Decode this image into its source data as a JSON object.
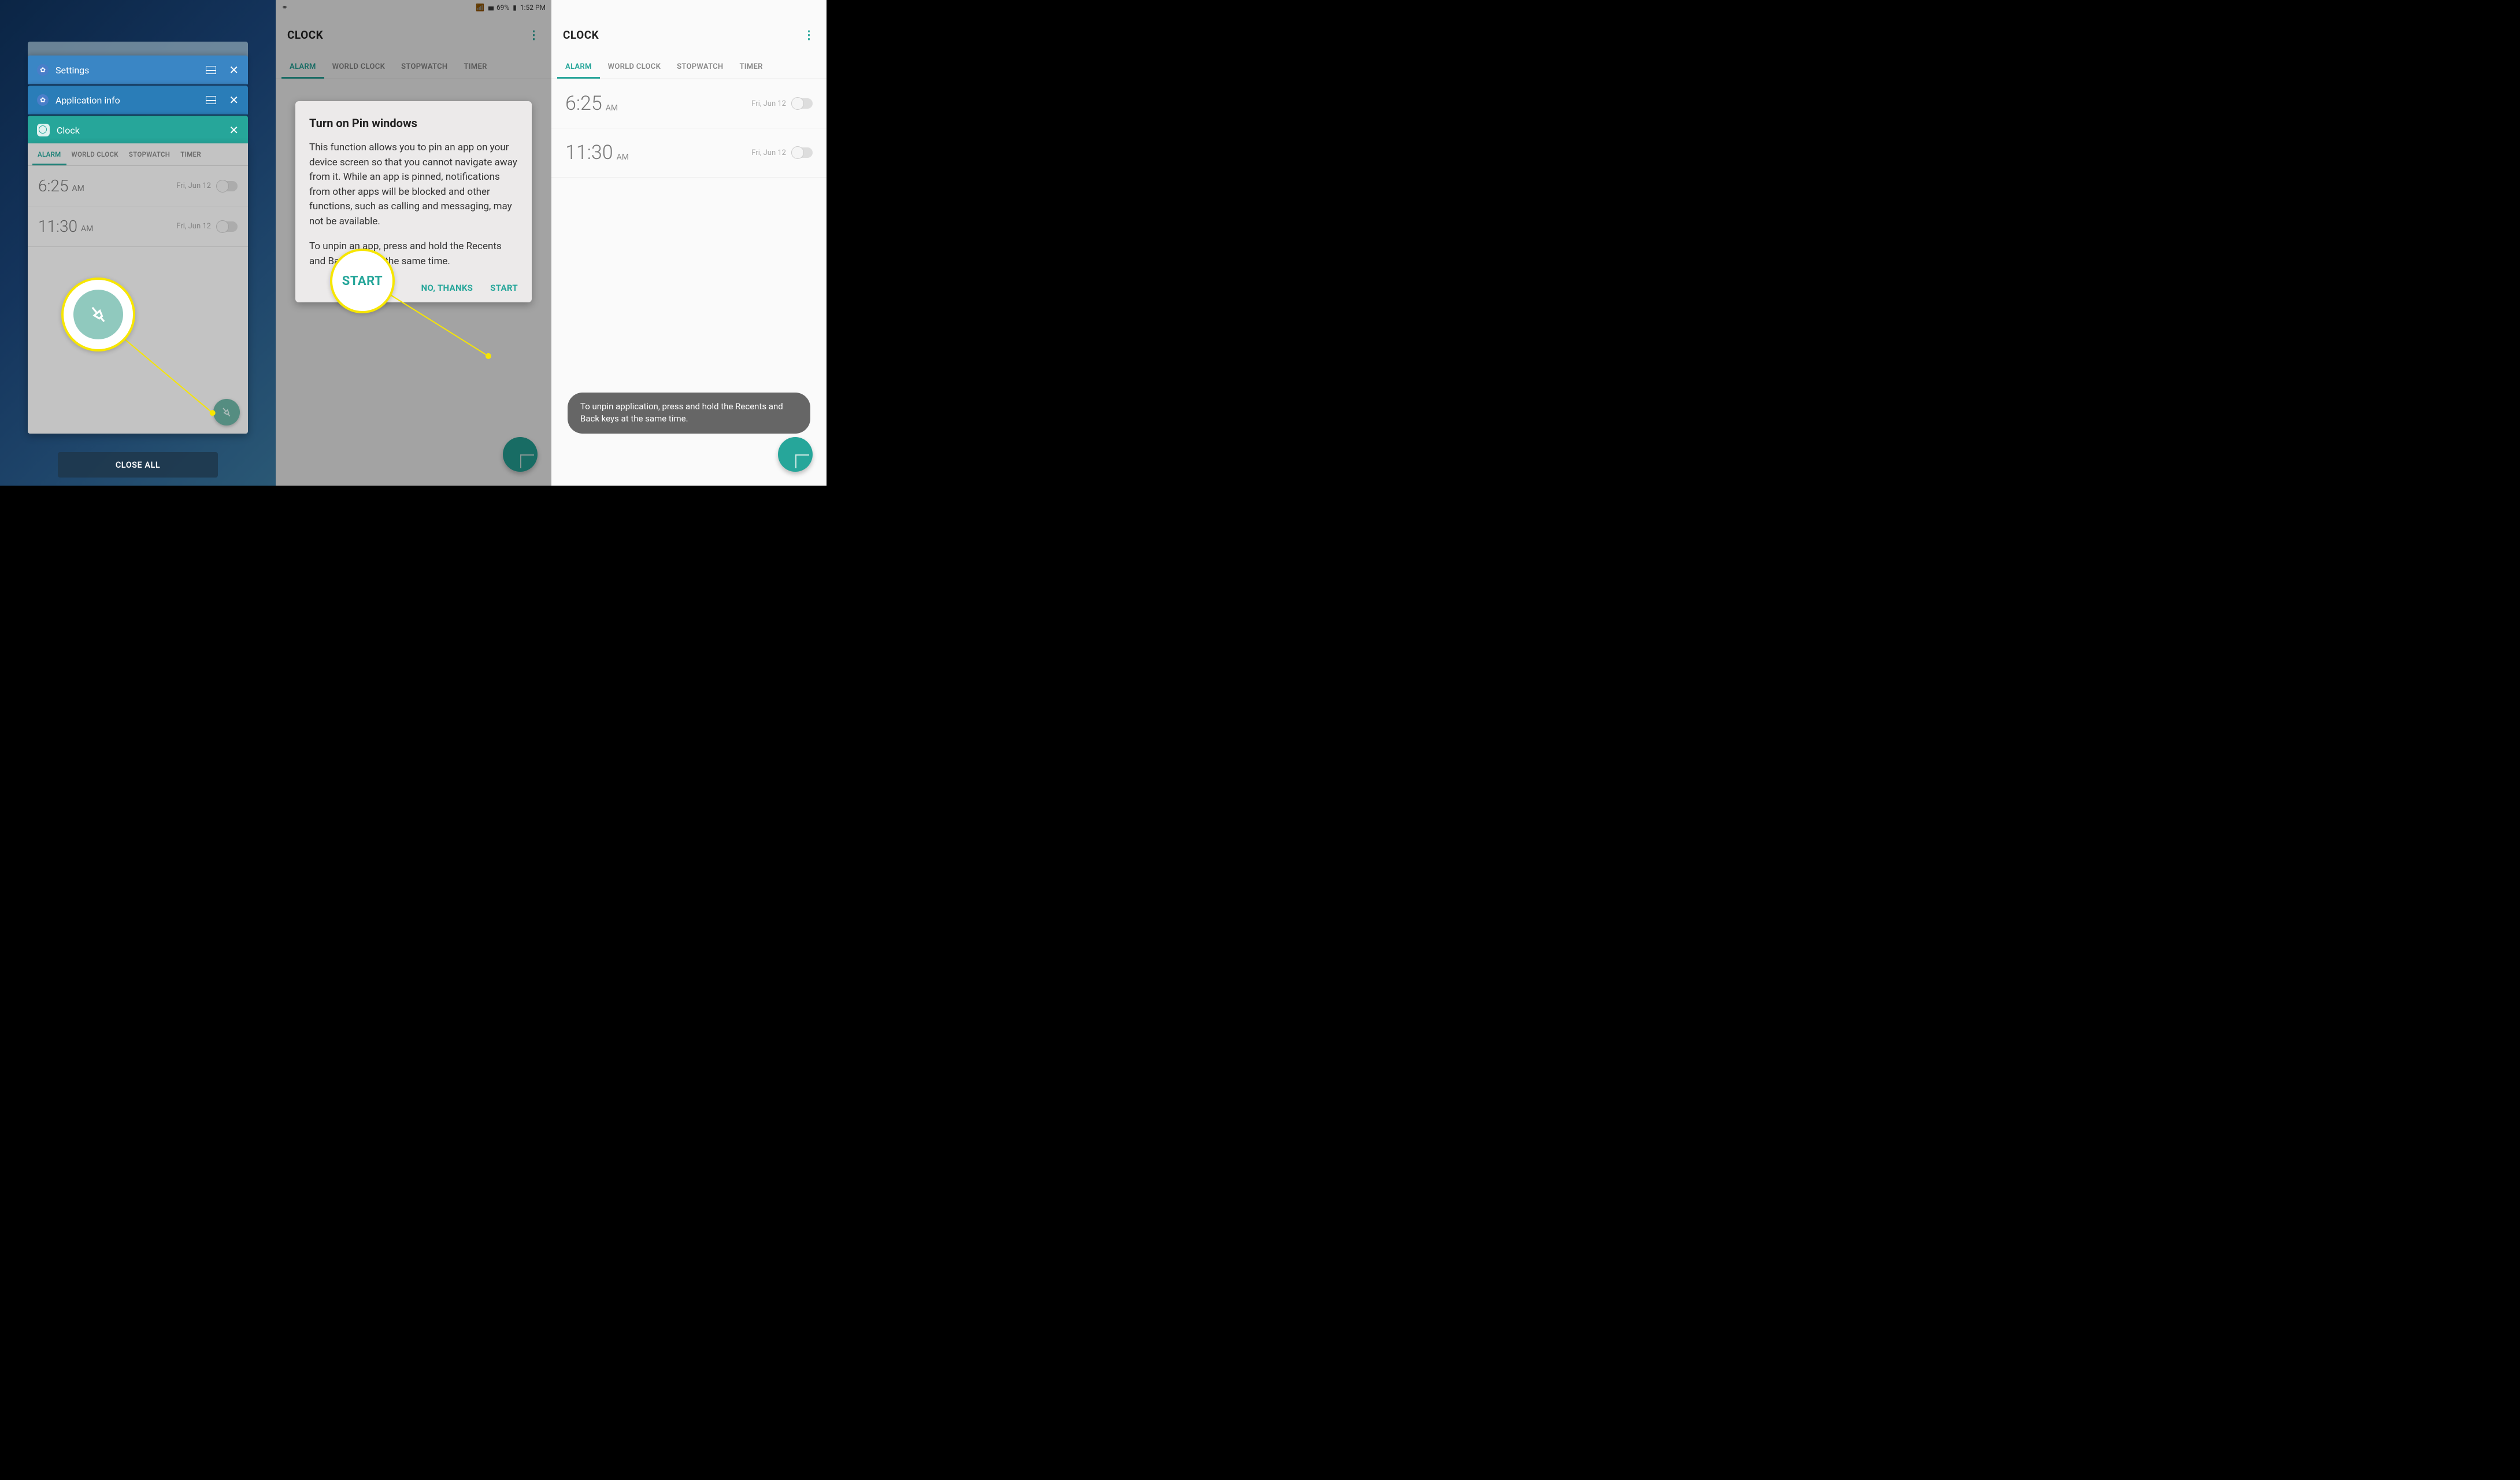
{
  "panel1": {
    "recents": {
      "cards": [
        {
          "title": "Settings"
        },
        {
          "title": "Application info"
        },
        {
          "title": "Clock"
        }
      ],
      "close_all": "CLOSE ALL"
    },
    "clock_preview": {
      "tabs": [
        "ALARM",
        "WORLD CLOCK",
        "STOPWATCH",
        "TIMER"
      ],
      "alarms": [
        {
          "time": "6:25",
          "ampm": "AM",
          "date": "Fri, Jun 12",
          "enabled": false
        },
        {
          "time": "11:30",
          "ampm": "AM",
          "date": "Fri, Jun 12",
          "enabled": false
        }
      ]
    }
  },
  "panel2": {
    "statusbar": {
      "battery": "69%",
      "time": "1:52 PM"
    },
    "clock": {
      "title": "CLOCK",
      "tabs": [
        "ALARM",
        "WORLD CLOCK",
        "STOPWATCH",
        "TIMER"
      ]
    },
    "dialog": {
      "title": "Turn on Pin windows",
      "body1": "This function allows you to pin an app on your device screen so that you cannot navigate away from it. While an app is pinned, notifications from other apps will be blocked and other functions, such as calling and messaging, may not be available.",
      "body2": "To unpin an app, press and hold the Recents and Back keys at the same time.",
      "no": "NO, THANKS",
      "start": "START"
    },
    "highlight_label": "START"
  },
  "panel3": {
    "clock": {
      "title": "CLOCK",
      "tabs": [
        "ALARM",
        "WORLD CLOCK",
        "STOPWATCH",
        "TIMER"
      ],
      "alarms": [
        {
          "time": "6:25",
          "ampm": "AM",
          "date": "Fri, Jun 12",
          "enabled": false
        },
        {
          "time": "11:30",
          "ampm": "AM",
          "date": "Fri, Jun 12",
          "enabled": false
        }
      ]
    },
    "toast": "To unpin application, press and hold the Recents and Back keys at the same time."
  },
  "colors": {
    "accent": "#26a69a",
    "highlight": "#f7e600"
  }
}
